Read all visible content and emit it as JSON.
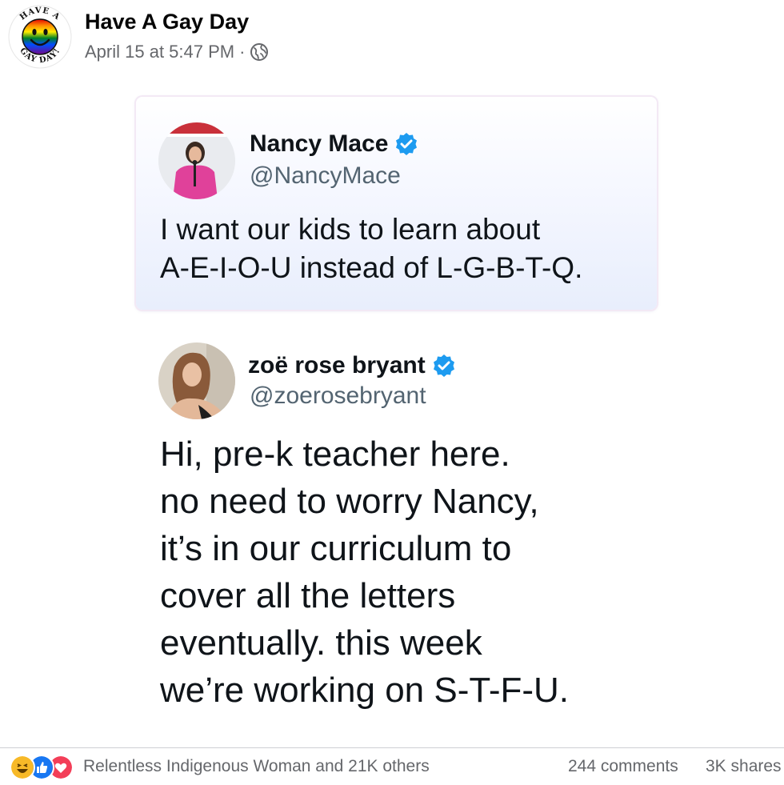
{
  "post": {
    "page_name": "Have A Gay Day",
    "logo_text_top": "HAVE A",
    "logo_text_bottom": "GAY DAY!",
    "timestamp": "April 15 at 5:47 PM",
    "separator": "·",
    "privacy_icon": "globe-icon"
  },
  "tweet1": {
    "name": "Nancy Mace",
    "handle": "@NancyMace",
    "verified": true,
    "lines": [
      "I want our kids to learn about",
      "A-E-I-O-U instead of L-G-B-T-Q."
    ]
  },
  "tweet2": {
    "name": "zoë rose bryant",
    "handle": "@zoerosebryant",
    "verified": true,
    "lines": [
      "Hi, pre-k teacher here.",
      "no need to worry Nancy,",
      "it’s in our curriculum to",
      "cover all the letters",
      "eventually. this week",
      "we’re working on S-T-F-U."
    ]
  },
  "footer": {
    "reaction_icons": [
      "haha-icon",
      "like-icon",
      "love-icon"
    ],
    "reaction_summary": "Relentless Indigenous Woman and 21K others",
    "comments": "244 comments",
    "shares": "3K shares"
  },
  "colors": {
    "verified_blue": "#1d9bf0",
    "meta_gray": "#65676b",
    "handle_gray": "#536471",
    "like_blue": "#1877f2",
    "love_red": "#f33e58",
    "haha_yellow": "#f7b928"
  }
}
